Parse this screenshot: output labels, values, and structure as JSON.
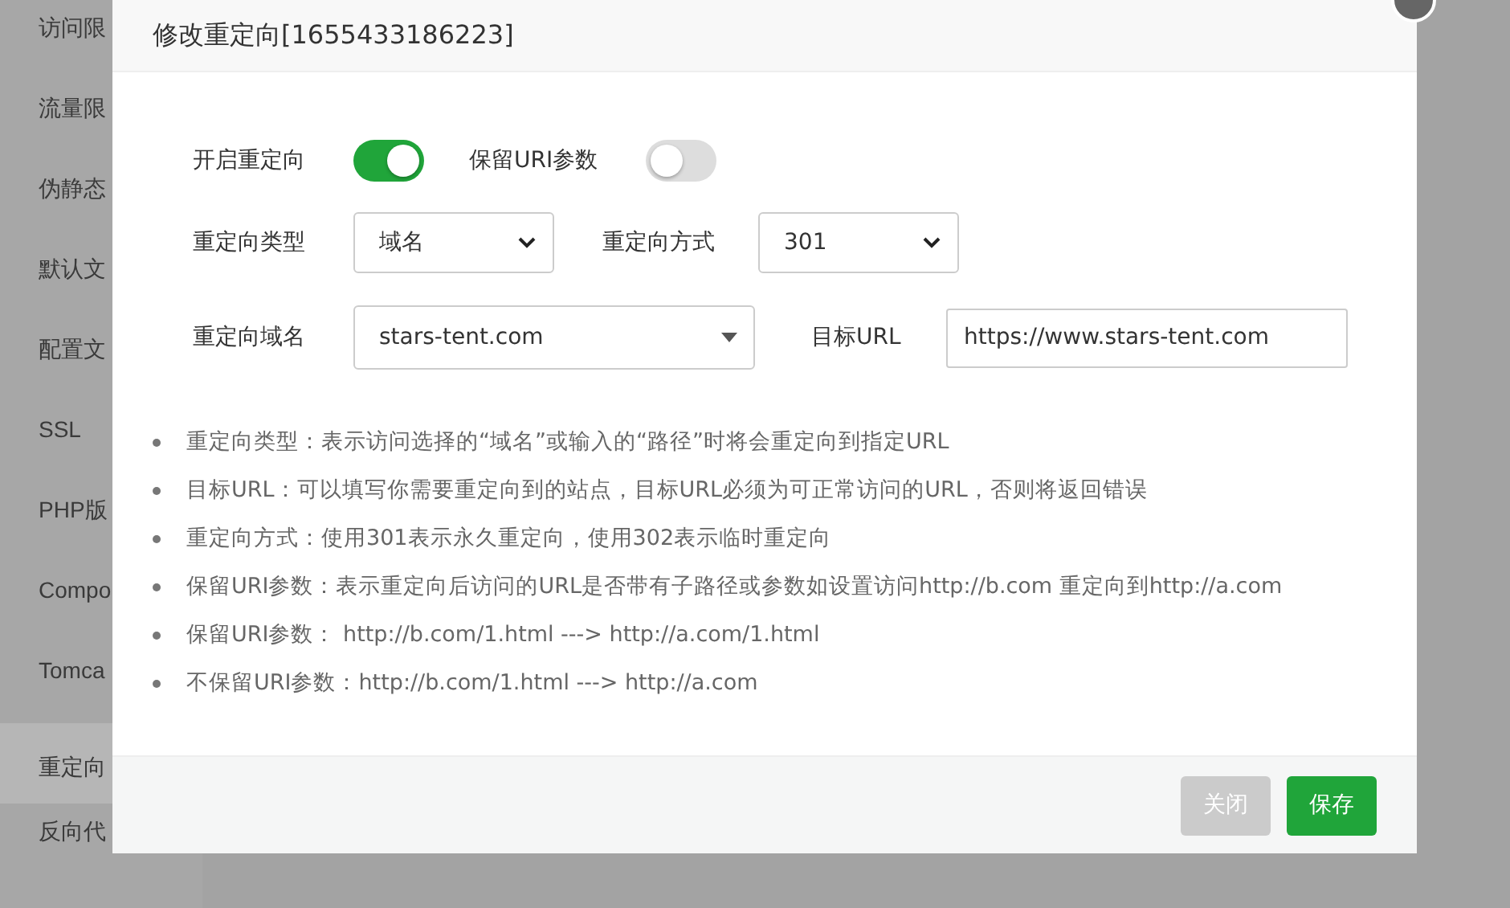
{
  "sidebar": {
    "items": [
      {
        "label": "访问限",
        "selected": false
      },
      {
        "label": "流量限",
        "selected": false
      },
      {
        "label": "伪静态",
        "selected": false
      },
      {
        "label": "默认文",
        "selected": false
      },
      {
        "label": "配置文",
        "selected": false
      },
      {
        "label": "SSL",
        "selected": false
      },
      {
        "label": "PHP版",
        "selected": false
      },
      {
        "label": "Compo",
        "selected": false
      },
      {
        "label": "Tomca",
        "selected": false
      },
      {
        "label": "重定向",
        "selected": true
      },
      {
        "label": "反向代",
        "selected": false
      }
    ]
  },
  "dialog": {
    "title": "修改重定向[1655433186223]",
    "toggles": [
      {
        "label": "开启重定向",
        "on": true
      },
      {
        "label": "保留URI参数",
        "on": false
      }
    ],
    "selects": [
      {
        "label": "重定向类型",
        "value": "域名"
      },
      {
        "label": "重定向方式",
        "value": "301"
      }
    ],
    "domain": {
      "label": "重定向域名",
      "value": "stars-tent.com"
    },
    "target": {
      "label": "目标URL",
      "value": "https://www.stars-tent.com"
    },
    "notes": [
      "重定向类型：表示访问选择的“域名”或输入的“路径”时将会重定向到指定URL",
      "目标URL：可以填写你需要重定向到的站点，目标URL必须为可正常访问的URL，否则将返回错误",
      "重定向方式：使用301表示永久重定向，使用302表示临时重定向",
      "保留URI参数：表示重定向后访问的URL是否带有子路径或参数如设置访问http://b.com 重定向到http://a.com",
      "保留URI参数： http://b.com/1.html ---> http://a.com/1.html",
      "不保留URI参数：http://b.com/1.html ---> http://a.com"
    ],
    "buttons": [
      {
        "label": "关闭",
        "kind": "secondary"
      },
      {
        "label": "保存",
        "kind": "primary"
      }
    ]
  }
}
